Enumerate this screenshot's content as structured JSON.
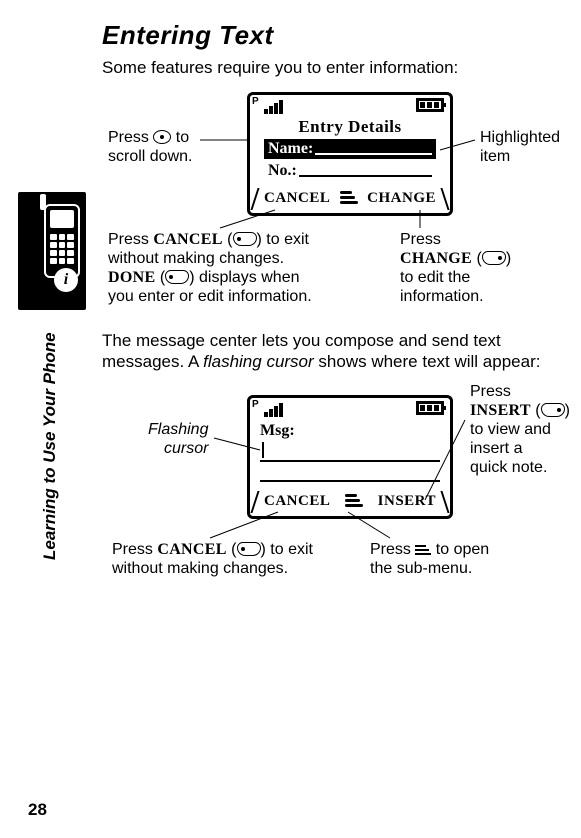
{
  "page_number": "28",
  "section_label": "Learning to Use Your Phone",
  "title": "Entering Text",
  "intro": "Some features require you to enter information:",
  "screen1": {
    "title": "Entry Details",
    "row_name_label": "Name:",
    "row_no_label": "No.:",
    "left_softkey": "CANCEL",
    "right_softkey": "CHANGE"
  },
  "callouts1": {
    "scroll_a": "Press ",
    "scroll_b": " to",
    "scroll_c": "scroll down.",
    "highlighted_a": "Highlighted",
    "highlighted_b": "item",
    "cancel_a": "Press ",
    "cancel_b": " (",
    "cancel_c": ") to exit",
    "cancel_d": "without making changes.",
    "done_a": " (",
    "done_b": ") displays when",
    "done_c": "you enter or edit information.",
    "cancel_word": "CANCEL",
    "done_word": "DONE",
    "change_a": "Press",
    "change_word": "CHANGE",
    "change_b": " (",
    "change_c": ")",
    "change_d": "to edit the",
    "change_e": "information."
  },
  "para2_a": "The message center lets you compose and send text",
  "para2_b": "messages. A ",
  "para2_c": "flashing cursor",
  "para2_d": " shows where text will appear:",
  "screen2": {
    "msg_label": "Msg:",
    "left_softkey": "CANCEL",
    "right_softkey": "INSERT"
  },
  "callouts2": {
    "flashing_a": "Flashing",
    "flashing_b": "cursor",
    "insert_a": "Press",
    "insert_word": "INSERT",
    "insert_b": " (",
    "insert_c": ")",
    "insert_d": "to view and",
    "insert_e": "insert a",
    "insert_f": "quick note.",
    "cancel_a": "Press ",
    "cancel_word": "CANCEL",
    "cancel_b": " (",
    "cancel_c": ") to exit",
    "cancel_d": "without making changes.",
    "menu_a": "Press ",
    "menu_b": " to open",
    "menu_c": "the sub-menu."
  }
}
